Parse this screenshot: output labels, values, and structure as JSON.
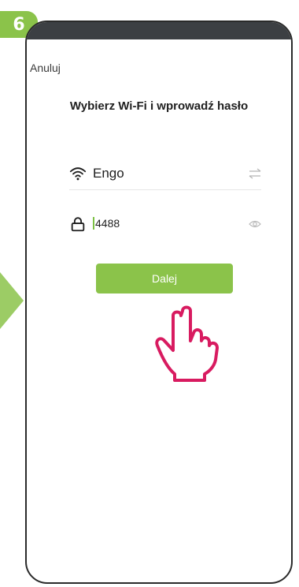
{
  "step": {
    "number": "6"
  },
  "header": {
    "cancel_label": "Anuluj"
  },
  "main": {
    "title": "Wybierz Wi-Fi i wprowadź hasło",
    "wifi": {
      "ssid": "Engo",
      "icon": "wifi-icon",
      "action_icon": "swap-icon"
    },
    "password": {
      "value": "4488",
      "icon": "lock-icon",
      "action_icon": "eye-icon"
    },
    "next_label": "Dalej"
  },
  "colors": {
    "accent": "#8bc34a",
    "pointer": "#d81b60"
  }
}
